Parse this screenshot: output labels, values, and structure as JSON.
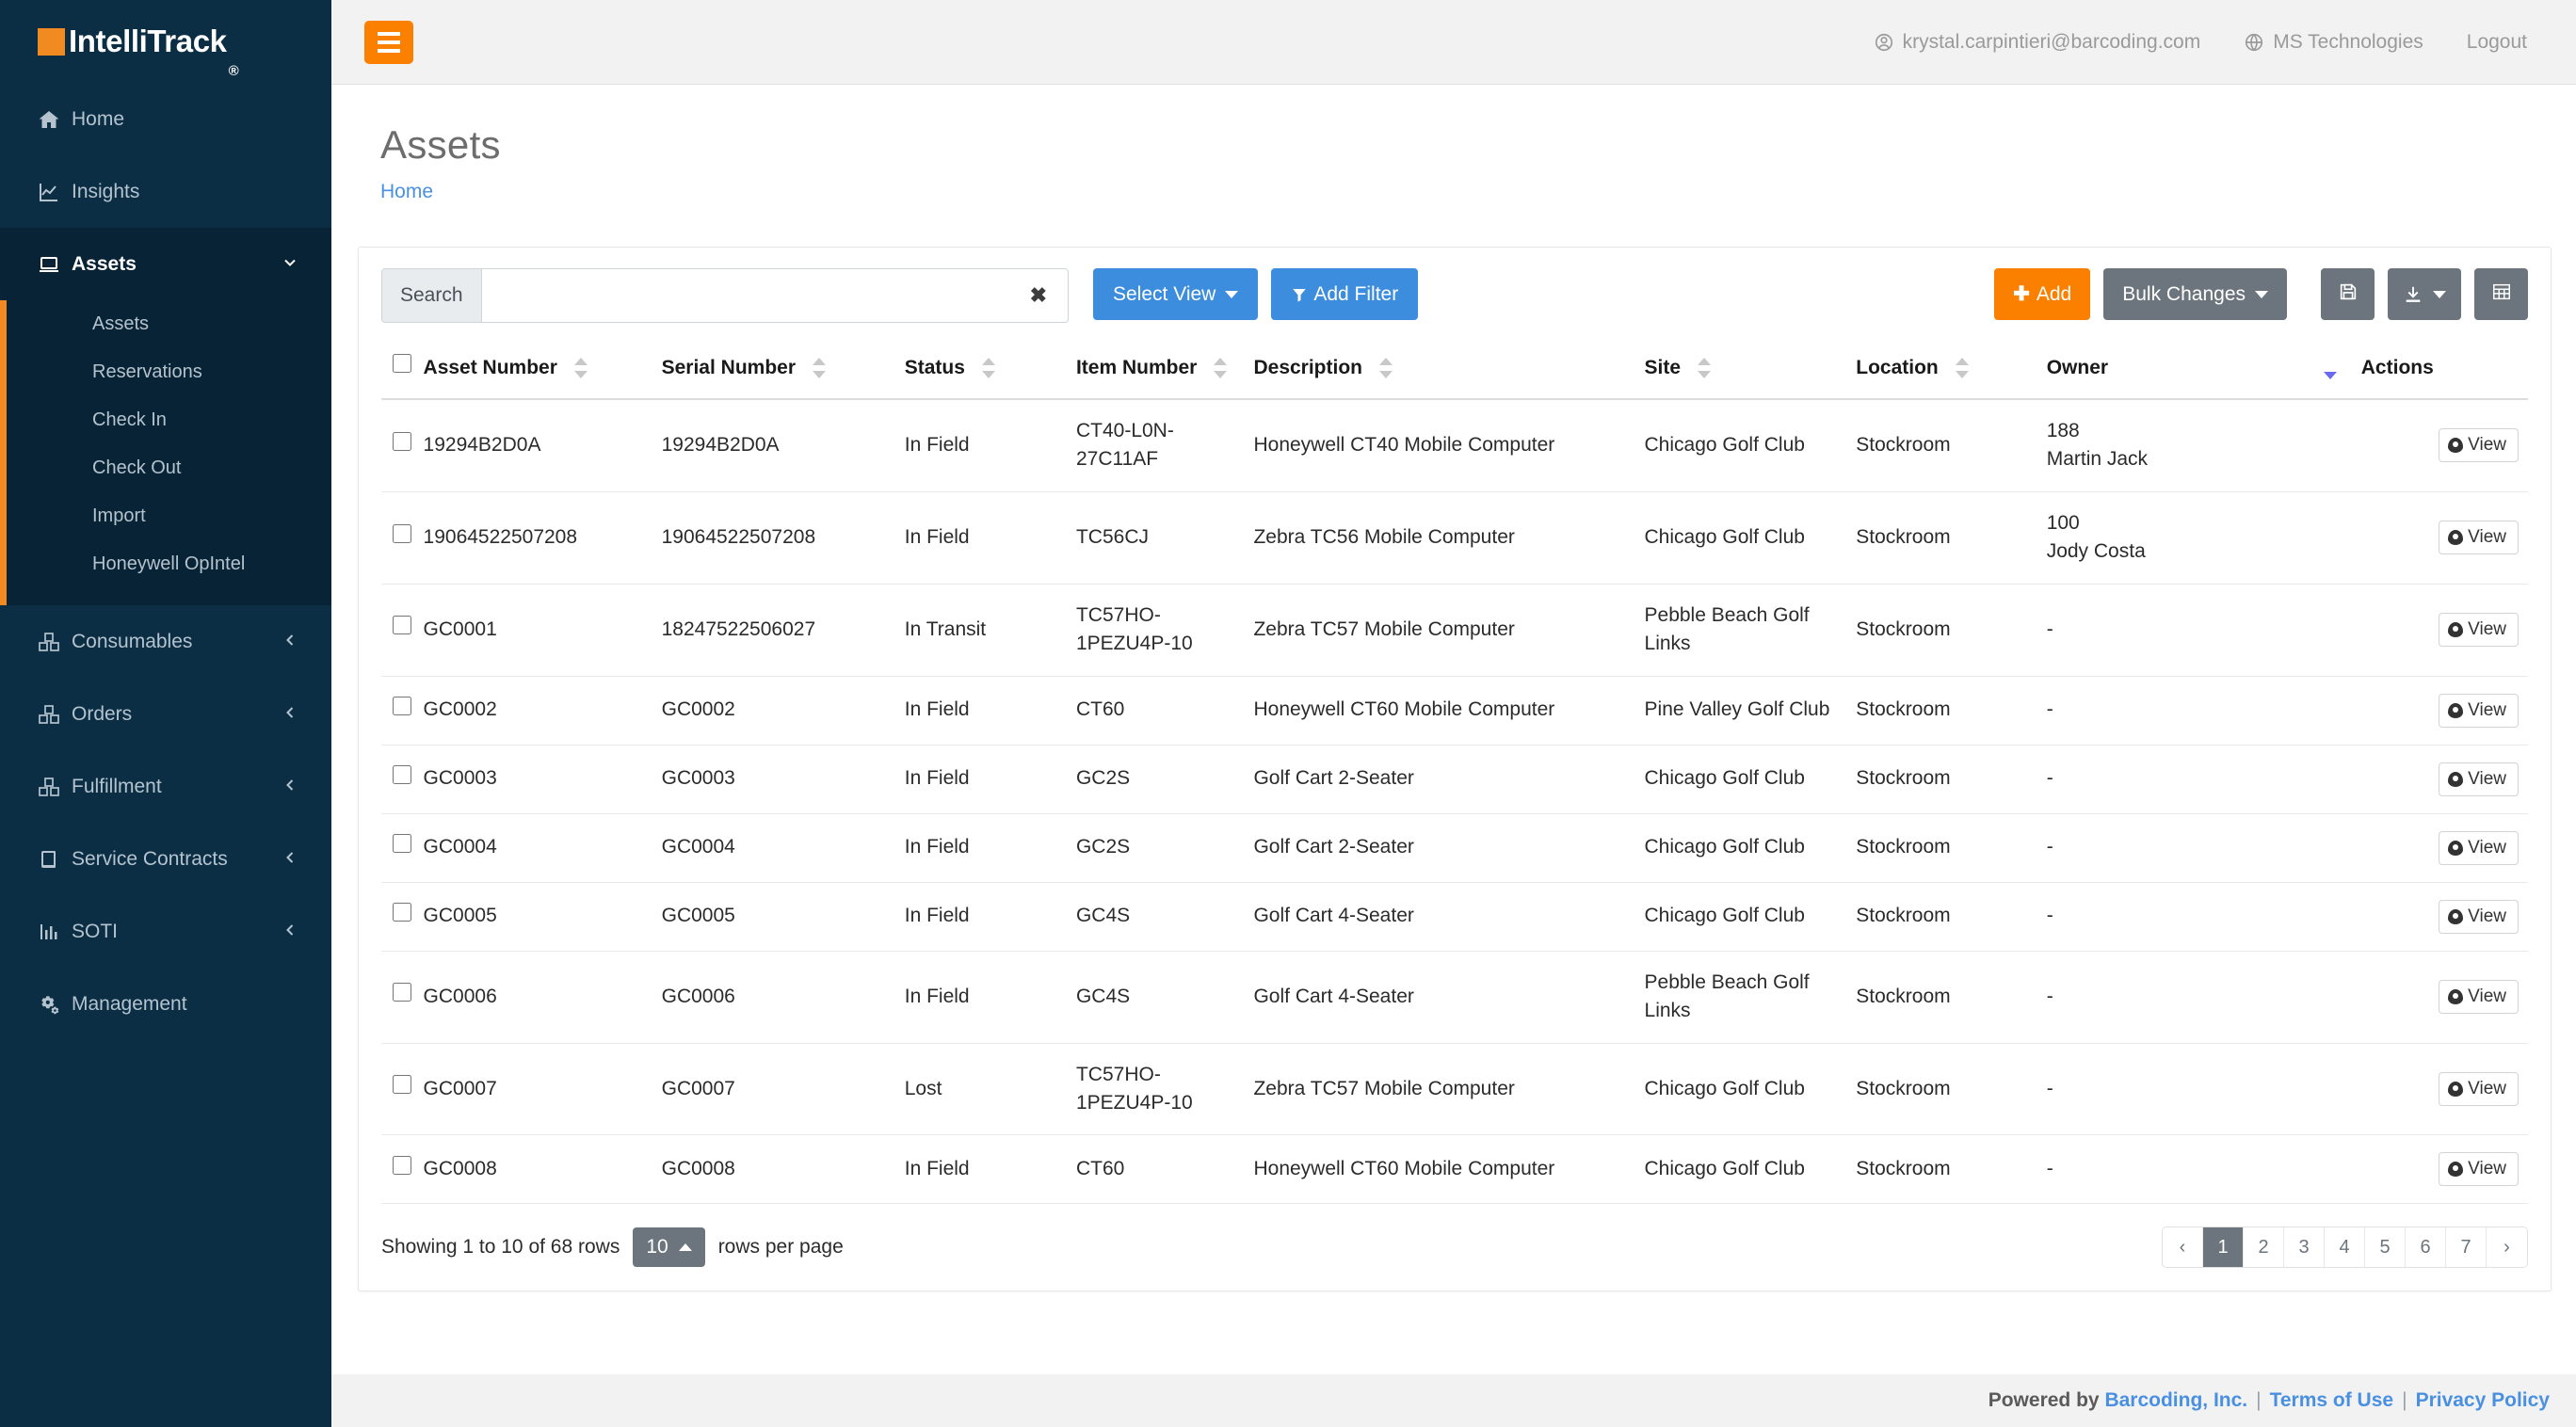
{
  "brand": {
    "name": "IntelliTrack",
    "registered": "®",
    "square_color": "#f28a22"
  },
  "topbar": {
    "user_email": "krystal.carpintieri@barcoding.com",
    "tenant": "MS Technologies",
    "logout": "Logout"
  },
  "sidebar": {
    "items": [
      {
        "label": "Home",
        "icon": "home-icon",
        "caret": "",
        "active": false
      },
      {
        "label": "Insights",
        "icon": "chart-line-icon",
        "caret": "",
        "active": false
      },
      {
        "label": "Assets",
        "icon": "laptop-icon",
        "caret": "chevron-down",
        "active": true
      },
      {
        "label": "Consumables",
        "icon": "boxes-icon",
        "caret": "chevron-left",
        "active": false
      },
      {
        "label": "Orders",
        "icon": "boxes-icon",
        "caret": "chevron-left",
        "active": false
      },
      {
        "label": "Fulfillment",
        "icon": "boxes-icon",
        "caret": "chevron-left",
        "active": false
      },
      {
        "label": "Service Contracts",
        "icon": "book-icon",
        "caret": "chevron-left",
        "active": false
      },
      {
        "label": "SOTI",
        "icon": "chart-bar-icon",
        "caret": "chevron-left",
        "active": false
      },
      {
        "label": "Management",
        "icon": "cogs-icon",
        "caret": "",
        "active": false
      }
    ],
    "assets_submenu": [
      "Assets",
      "Reservations",
      "Check In",
      "Check Out",
      "Import",
      "Honeywell OpIntel"
    ]
  },
  "page": {
    "title": "Assets",
    "breadcrumb": "Home"
  },
  "toolbar": {
    "search_label": "Search",
    "search_value": "",
    "search_placeholder": "",
    "clear_icon": "✖",
    "select_view": "Select View",
    "add_filter": "Add Filter",
    "add": "Add",
    "bulk_changes": "Bulk Changes",
    "save_icon": "floppy-disk-icon",
    "download_icon": "download-icon",
    "columns_icon": "table-grid-icon"
  },
  "table": {
    "columns": [
      {
        "label": "",
        "key": "chk",
        "sortable": false
      },
      {
        "label": "Asset Number",
        "key": "asset_number",
        "sortable": true
      },
      {
        "label": "Serial Number",
        "key": "serial_number",
        "sortable": true
      },
      {
        "label": "Status",
        "key": "status",
        "sortable": true
      },
      {
        "label": "Item Number",
        "key": "item_number",
        "sortable": true
      },
      {
        "label": "Description",
        "key": "description",
        "sortable": true
      },
      {
        "label": "Site",
        "key": "site",
        "sortable": true
      },
      {
        "label": "Location",
        "key": "location",
        "sortable": true
      },
      {
        "label": "Owner",
        "key": "owner",
        "sortable": true,
        "sort_state": "desc"
      },
      {
        "label": "Actions",
        "key": "actions",
        "sortable": false
      }
    ],
    "row_action_label": "View",
    "rows": [
      {
        "asset_number": "19294B2D0A",
        "serial_number": "19294B2D0A",
        "status": "In Field",
        "item_number": "CT40-L0N-27C11AF",
        "description": "Honeywell CT40 Mobile Computer",
        "site": "Chicago Golf Club",
        "location": "Stockroom",
        "owner_id": "188",
        "owner_name": "Martin Jack"
      },
      {
        "asset_number": "19064522507208",
        "serial_number": "19064522507208",
        "status": "In Field",
        "item_number": "TC56CJ",
        "description": "Zebra TC56 Mobile Computer",
        "site": "Chicago Golf Club",
        "location": "Stockroom",
        "owner_id": "100",
        "owner_name": "Jody Costa"
      },
      {
        "asset_number": "GC0001",
        "serial_number": "18247522506027",
        "status": "In Transit",
        "item_number": "TC57HO-1PEZU4P-10",
        "description": "Zebra TC57 Mobile Computer",
        "site": "Pebble Beach Golf Links",
        "location": "Stockroom",
        "owner_id": "-",
        "owner_name": ""
      },
      {
        "asset_number": "GC0002",
        "serial_number": "GC0002",
        "status": "In Field",
        "item_number": "CT60",
        "description": "Honeywell CT60 Mobile Computer",
        "site": "Pine Valley Golf Club",
        "location": "Stockroom",
        "owner_id": "-",
        "owner_name": ""
      },
      {
        "asset_number": "GC0003",
        "serial_number": "GC0003",
        "status": "In Field",
        "item_number": "GC2S",
        "description": "Golf Cart 2-Seater",
        "site": "Chicago Golf Club",
        "location": "Stockroom",
        "owner_id": "-",
        "owner_name": ""
      },
      {
        "asset_number": "GC0004",
        "serial_number": "GC0004",
        "status": "In Field",
        "item_number": "GC2S",
        "description": "Golf Cart 2-Seater",
        "site": "Chicago Golf Club",
        "location": "Stockroom",
        "owner_id": "-",
        "owner_name": ""
      },
      {
        "asset_number": "GC0005",
        "serial_number": "GC0005",
        "status": "In Field",
        "item_number": "GC4S",
        "description": "Golf Cart 4-Seater",
        "site": "Chicago Golf Club",
        "location": "Stockroom",
        "owner_id": "-",
        "owner_name": ""
      },
      {
        "asset_number": "GC0006",
        "serial_number": "GC0006",
        "status": "In Field",
        "item_number": "GC4S",
        "description": "Golf Cart 4-Seater",
        "site": "Pebble Beach Golf Links",
        "location": "Stockroom",
        "owner_id": "-",
        "owner_name": ""
      },
      {
        "asset_number": "GC0007",
        "serial_number": "GC0007",
        "status": "Lost",
        "item_number": "TC57HO-1PEZU4P-10",
        "description": "Zebra TC57 Mobile Computer",
        "site": "Chicago Golf Club",
        "location": "Stockroom",
        "owner_id": "-",
        "owner_name": ""
      },
      {
        "asset_number": "GC0008",
        "serial_number": "GC0008",
        "status": "In Field",
        "item_number": "CT60",
        "description": "Honeywell CT60 Mobile Computer",
        "site": "Chicago Golf Club",
        "location": "Stockroom",
        "owner_id": "-",
        "owner_name": ""
      }
    ]
  },
  "pagination": {
    "showing_text": "Showing 1 to 10 of 68 rows",
    "rows_per_page_value": "10",
    "rows_per_page_label": "rows per page",
    "prev": "‹",
    "next": "›",
    "pages": [
      "1",
      "2",
      "3",
      "4",
      "5",
      "6",
      "7"
    ],
    "current_page": "1"
  },
  "footer": {
    "powered_by": "Powered by",
    "company": "Barcoding, Inc.",
    "terms": "Terms of Use",
    "privacy": "Privacy Policy",
    "sep": "|"
  },
  "colors": {
    "sidebar_bg": "#0b2e45",
    "sidebar_active_bg": "#082335",
    "accent_orange": "#fb8000",
    "accent_blue": "#3c8dde",
    "gray_button": "#6c757d",
    "link_blue": "#4a90e2"
  }
}
